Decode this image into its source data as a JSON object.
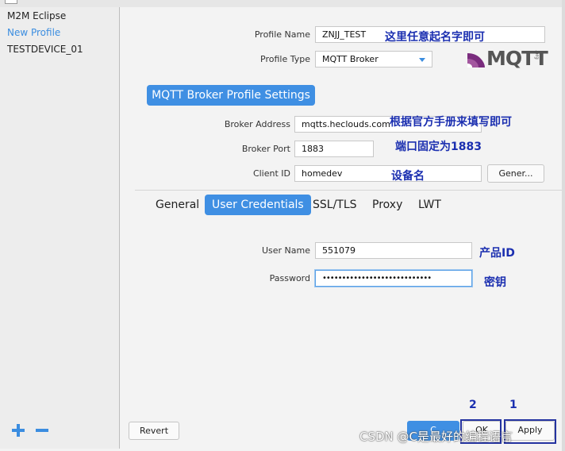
{
  "sidebar": {
    "items": [
      "M2M Eclipse",
      "New Profile",
      "TESTDEVICE_01"
    ],
    "add_icon": "plus-icon",
    "remove_icon": "minus-icon"
  },
  "form": {
    "profile_name_label": "Profile Name",
    "profile_name_value": "ZNJJ_TEST",
    "profile_type_label": "Profile Type",
    "profile_type_value": "MQTT Broker",
    "section_title": "MQTT Broker Profile Settings",
    "broker_address_label": "Broker Address",
    "broker_address_value": "mqtts.heclouds.com",
    "broker_port_label": "Broker Port",
    "broker_port_value": "1883",
    "client_id_label": "Client ID",
    "client_id_value": "homedev",
    "generate_label": "Gener..."
  },
  "logo": {
    "word": "MQTT",
    "org": ".org"
  },
  "tabs": [
    "General",
    "User Credentials",
    "SSL/TLS",
    "Proxy",
    "LWT"
  ],
  "active_tab": "User Credentials",
  "credentials": {
    "username_label": "User Name",
    "username_value": "551079",
    "password_label": "Password",
    "password_mask": "••••••••••••••••••••••••••••"
  },
  "buttons": {
    "revert": "Revert",
    "cancel": "C",
    "ok": "OK",
    "apply": "Apply"
  },
  "annotations": {
    "profile_name_note": "这里任意起名字即可",
    "broker_address_note": "根据官方手册来填写即可",
    "port_note": "端口固定为1883",
    "client_id_note": "设备名",
    "username_note": "产品ID",
    "password_note": "密钥",
    "ok_number": "2",
    "apply_number": "1"
  },
  "watermark": "CSDN @C是最好的编程语言",
  "colors": {
    "accent": "#3f8fe3",
    "annotation": "#1b2fb0"
  }
}
